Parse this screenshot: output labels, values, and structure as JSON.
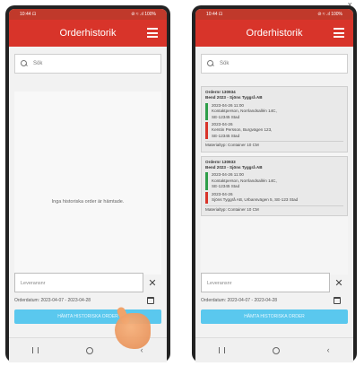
{
  "colors": {
    "accent": "#d8342a",
    "button": "#5ac8ee",
    "status_green": "#2e9e49",
    "status_red": "#d8342a"
  },
  "phones": {
    "left": {
      "status_left": "10:44 ⊡",
      "status_right": "⊘ ≈ .ıl 100%",
      "title": "Orderhistorik",
      "search_placeholder": "Sök",
      "empty_message": "Inga historiska order är hämtade.",
      "name_placeholder": "Leveransnr",
      "date_range": "Orderdatum: 2023-04-07 - 2023-04-28",
      "button_label": "HÄMTA HISTORISKA ORDER"
    },
    "right": {
      "status_left": "10:44 ⊡",
      "status_right": "⊘ ≈ .ıl 100%",
      "title": "Orderhistorik",
      "search_placeholder": "Sök",
      "orders": [
        {
          "header": "Ordernr 130934",
          "customer": "Bend 2023 - Sjöns Tyggrå AB",
          "green_lines": [
            "2023-04-26 11:00",
            "Kontaktperson, Norrlandsallén 14C,",
            "SE-12345 Stad"
          ],
          "red_lines": [
            "2023-04-26",
            "Kerstin Persson, Burgvägen 123,",
            "SE-12345 Stad"
          ],
          "footer": "Materialtyp: Container 10 CM"
        },
        {
          "header": "Ordernr 130933",
          "customer": "Bend 2023 - Sjöns Tyggrå AB",
          "green_lines": [
            "2023-04-26 11:00",
            "Kontaktperson, Norrlandsallén 14C,",
            "SE-12345 Stad"
          ],
          "red_lines": [
            "2023-04-26",
            "Sjöns Tyggrå AB, Urbansvägen 5, SE-123 Stad"
          ],
          "footer": "Materialtyp: Container 10 CM"
        }
      ],
      "name_placeholder": "Leveransnr",
      "date_range": "Orderdatum: 2023-04-07 - 2023-04-28",
      "button_label": "HÄMTA HISTORISKA ORDER"
    }
  },
  "corner_close": "x",
  "clear_symbol": "✕"
}
